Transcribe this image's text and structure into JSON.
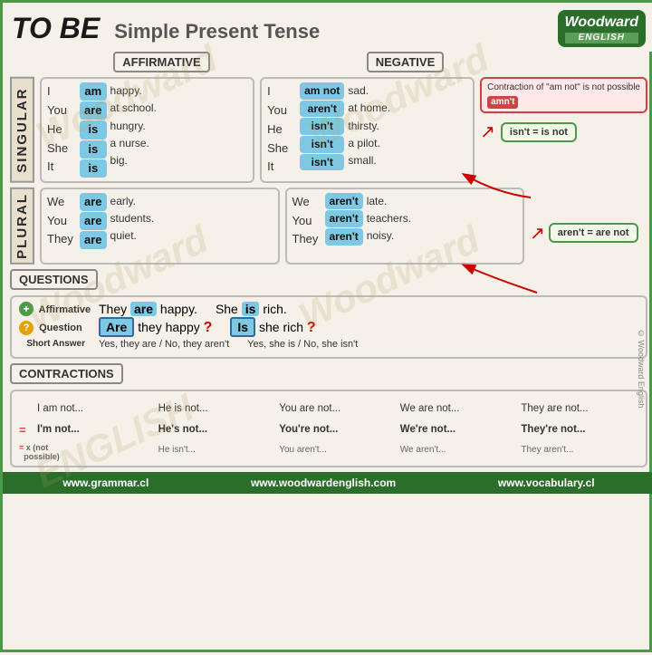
{
  "title": "TO BE",
  "subtitle": "Simple Present Tense",
  "logo": {
    "brand": "Woodward",
    "sub": "ENGLISH"
  },
  "header_labels": {
    "affirmative": "AFFIRMATIVE",
    "negative": "NEGATIVE"
  },
  "singular_label": "SINGULAR",
  "plural_label": "PLURAL",
  "singular": {
    "affirmative": {
      "pronouns": [
        "I",
        "You",
        "He",
        "She",
        "It"
      ],
      "verbs": [
        "am",
        "are",
        "is",
        "is",
        "is"
      ],
      "sentences": [
        "happy.",
        "at school.",
        "hungry.",
        "a nurse.",
        "big."
      ]
    },
    "negative": {
      "pronouns": [
        "I",
        "You",
        "He",
        "She",
        "It"
      ],
      "verbs": [
        "am not",
        "aren't",
        "isn't",
        "isn't",
        "isn't"
      ],
      "sentences": [
        "sad.",
        "at home.",
        "thirsty.",
        "a pilot.",
        "small."
      ]
    }
  },
  "plural": {
    "affirmative": {
      "pronouns": [
        "We",
        "You",
        "They"
      ],
      "verbs": [
        "are",
        "are",
        "are"
      ],
      "sentences": [
        "early.",
        "students.",
        "quiet."
      ]
    },
    "negative": {
      "pronouns": [
        "We",
        "You",
        "They"
      ],
      "verbs": [
        "aren't",
        "aren't",
        "aren't"
      ],
      "sentences": [
        "late.",
        "teachers.",
        "noisy."
      ]
    }
  },
  "callouts": {
    "amn_label": "Contraction of \"am not\" is not possible",
    "amn_word": "amn't",
    "isnt_eq": "isn't = is not",
    "arent_eq": "aren't = are not"
  },
  "questions": {
    "section_label": "QUESTIONS",
    "affirmative_label": "Affirmative",
    "question_label": "Question",
    "short_answer_label": "Short Answer",
    "examples": [
      {
        "affirmative": "They are happy.",
        "are_highlight": "are",
        "question": "Are they happy ?",
        "are_q_highlight": "Are",
        "short_answer": "Yes, they are / No, they aren't"
      },
      {
        "affirmative": "She is rich.",
        "is_highlight": "is",
        "question": "Is she rich ?",
        "is_q_highlight": "Is",
        "short_answer": "Yes, she is / No, she isn't"
      }
    ]
  },
  "contractions": {
    "section_label": "CONTRACTIONS",
    "rows": [
      {
        "symbol": "",
        "cols": [
          "I am not...",
          "He is not...",
          "You are not...",
          "We are not...",
          "They are not..."
        ]
      },
      {
        "symbol": "=",
        "cols": [
          "I'm not...",
          "He's not...",
          "You're not...",
          "We're not...",
          "They're not..."
        ]
      },
      {
        "symbol": "= x (not possible)",
        "cols": [
          "He isn't...",
          "You aren't...",
          "We aren't...",
          "They aren't..."
        ]
      }
    ]
  },
  "footer": {
    "links": [
      "www.grammar.cl",
      "www.woodwardenglish.com",
      "www.vocabulary.cl"
    ]
  }
}
